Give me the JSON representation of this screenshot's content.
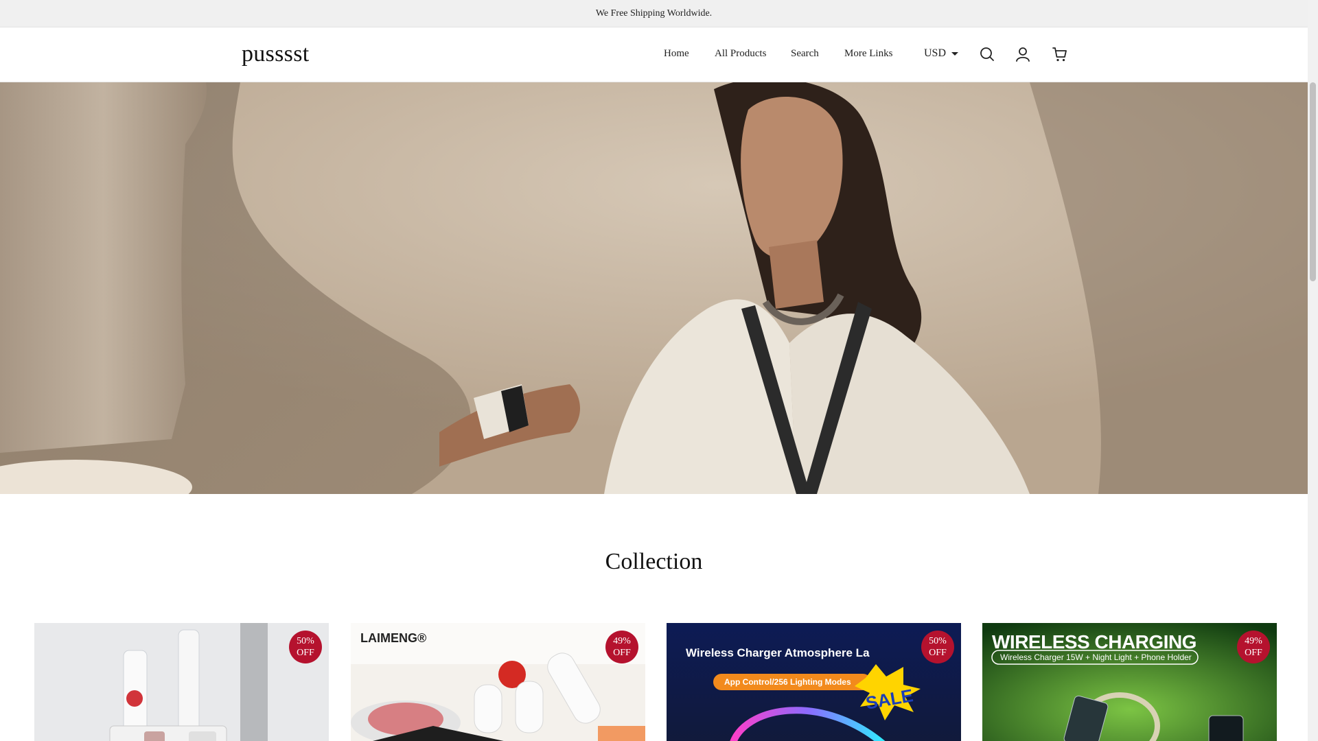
{
  "announcement": "We Free Shipping Worldwide.",
  "header": {
    "logo": "pusssst",
    "nav": [
      "Home",
      "All Products",
      "Search",
      "More Links"
    ],
    "currency": "USD",
    "icons": [
      "search-icon",
      "account-icon",
      "cart-icon"
    ]
  },
  "hero": {
    "image": "woman-in-embroidered-kaftan-photo"
  },
  "collection": {
    "title": "Collection",
    "products": [
      {
        "badge_pct": "50%",
        "badge_off": "OFF",
        "image": "toothpaste-dispenser"
      },
      {
        "badge_pct": "49%",
        "badge_off": "OFF",
        "image": "vacuum-sealer-rolls",
        "brand": "LAIMENG®"
      },
      {
        "badge_pct": "50%",
        "badge_off": "OFF",
        "image": "wireless-charger-lamp",
        "heading": "Wireless Charger Atmosphere La",
        "subheading": "App Control/256 Lighting Modes",
        "sale": "SALE"
      },
      {
        "badge_pct": "49%",
        "badge_off": "OFF",
        "image": "wireless-charging-stand",
        "heading": "WIRELESS CHARGING",
        "subheading": "Wireless Charger 15W + Night Light + Phone Holder"
      }
    ]
  },
  "colors": {
    "badge": "#b5122e",
    "announcement_bg": "#f0f0f0"
  }
}
